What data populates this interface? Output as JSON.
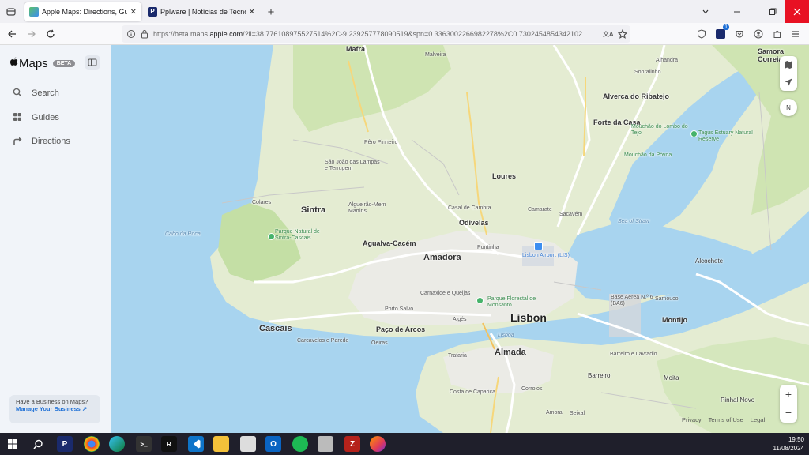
{
  "browser": {
    "tabs": [
      {
        "label": "Apple Maps: Directions, Guides & Traffic",
        "close": "✕"
      },
      {
        "label": "Pplware | Notícias de Tecnologia",
        "close": "✕"
      }
    ],
    "new_tab": "+",
    "url_prefix": "https://beta.maps.",
    "url_domain": "apple.com",
    "url_rest": "/?ll=38.776108975527514%2C-9.239257778090519&spn=0.3363002266982278%2C0.7302454854342102",
    "extension_badge": "1"
  },
  "sidebar": {
    "brand": "Maps",
    "beta_badge": "BETA",
    "items": [
      {
        "label": "Search",
        "icon": "search-icon"
      },
      {
        "label": "Guides",
        "icon": "guides-icon"
      },
      {
        "label": "Directions",
        "icon": "directions-icon"
      }
    ],
    "business": {
      "text": "Have a Business on Maps?",
      "link": "Manage Your Business ↗"
    }
  },
  "map": {
    "labels_major": [
      {
        "text": "Lisbon"
      },
      {
        "text": "Amadora"
      },
      {
        "text": "Sintra"
      },
      {
        "text": "Cascais"
      },
      {
        "text": "Almada"
      },
      {
        "text": "Odivelas"
      },
      {
        "text": "Loures"
      },
      {
        "text": "Agualva-Cacém"
      },
      {
        "text": "Mafra"
      },
      {
        "text": "Forte da Casa"
      },
      {
        "text": "Alverca do Ribatejo"
      },
      {
        "text": "Montijo"
      },
      {
        "text": "Paço de Arcos"
      },
      {
        "text": "Barreiro"
      },
      {
        "text": "Moita"
      },
      {
        "text": "Pinhal Novo"
      },
      {
        "text": "Samora Correia"
      },
      {
        "text": "Alcochete"
      }
    ],
    "labels_minor": [
      "Malveira",
      "Alhandra",
      "Sobralinho",
      "Mouchão do Lombo do Tejo",
      "Mouchão da Póvoa",
      "Pêro Pinheiro",
      "São João das Lampas e Terrugem",
      "Colares",
      "Algueirão-Mem Martins",
      "Casal de Cambra",
      "Camarate",
      "Sacavém",
      "Pontinha",
      "Carnaxide e Queijas",
      "Porto Salvo",
      "Algés",
      "Carcavelos e Parede",
      "Oeiras",
      "Trafaria",
      "Costa de Caparica",
      "Corroios",
      "Amora",
      "Seixal",
      "Barreiro e Lavradio",
      "Samouco",
      "Sea of Straw",
      "Cabo da Roca",
      "Lisbon Airport (LIS)",
      "Parque Natural de Sintra-Cascais",
      "Parque Florestal de Monsanto",
      "Tagus Estuary Natural Reserve",
      "Base Aérea N.º 6 (BA6)",
      "Lisboa"
    ],
    "footer": {
      "privacy": "Privacy",
      "terms": "Terms of Use",
      "legal": "Legal"
    },
    "controls": {
      "compass": "N",
      "zoom_in": "+",
      "zoom_out": "−"
    }
  },
  "taskbar": {
    "time": "19:50",
    "date": "11/08/2024"
  },
  "colors": {
    "water": "#a8d4ef",
    "land": "#e4ecd2",
    "green": "#c4dfa5",
    "urban": "#ececec",
    "road_major": "#ffffff",
    "accent": "#1d6fd6"
  }
}
